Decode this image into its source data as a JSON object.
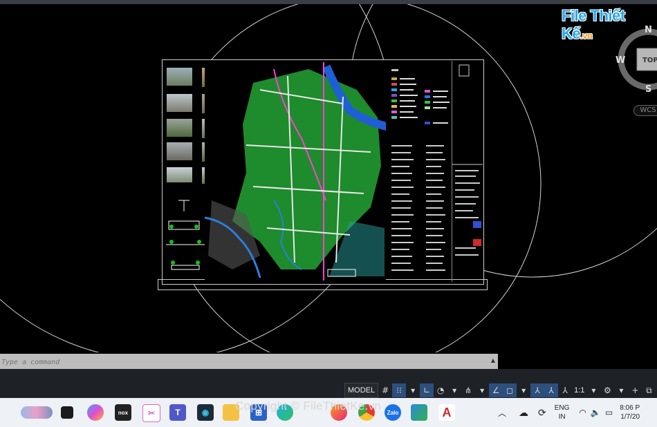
{
  "watermark": {
    "logo_main": "File Thiết Kế",
    "logo_suffix": ".vn",
    "copyright": "Copyright © FileThietKe.vn"
  },
  "viewcube": {
    "north": "N",
    "west": "W",
    "south": "S",
    "face": "TOP",
    "wcs": "WCS"
  },
  "command_line": {
    "placeholder": "Type a command",
    "expand_icon": "up-triangle-icon"
  },
  "status_bar": {
    "model_label": "MODEL",
    "scale_label": "1:1",
    "icons": [
      "grid-icon",
      "snap-icon",
      "ortho-icon",
      "polar-icon",
      "isodraft-icon",
      "osnap-icon",
      "otrack-icon",
      "annotation-icon",
      "autoscale-icon",
      "workspace-gear-icon",
      "plus-icon",
      "isolate-icon",
      "hardware-accel-icon"
    ]
  },
  "taskbar": {
    "apps": [
      "task-view",
      "copilot",
      "nox",
      "snipping",
      "teams",
      "app-dark",
      "file-explorer",
      "store",
      "edge",
      "firefox",
      "chrome",
      "zalo",
      "map-app",
      "autocad"
    ],
    "language": "ENG",
    "region": "IN",
    "time": "8:06 P",
    "date": "1/7/20"
  },
  "colors": {
    "canvas": "#000000",
    "map_green": "#1e8b2c",
    "river_blue": "#1f5fd6",
    "accent": "#2d4f7c"
  }
}
